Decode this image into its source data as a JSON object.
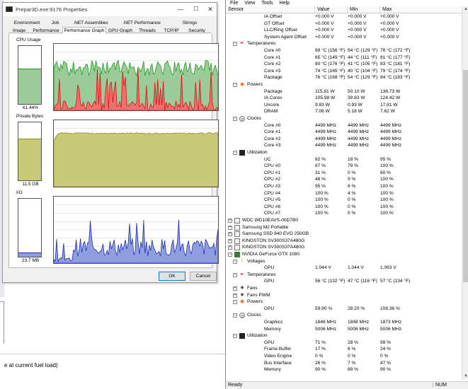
{
  "background": {
    "bottom_text": "e at current fuel load)"
  },
  "properties_window": {
    "title": "Prepar3D.exe:9176 Properties",
    "tabs_row1": [
      "Environment",
      "Job",
      ".NET Assemblies",
      ".NET Performance",
      "Strings"
    ],
    "tabs_row2": [
      "Image",
      "Performance",
      "Performance Graph",
      "GPU Graph",
      "Threads",
      "TCP/IP",
      "Security"
    ],
    "active_tab": "Performance Graph",
    "cpu": {
      "label": "CPU Usage",
      "value_text": "61.44%",
      "level": 0.6144
    },
    "private_bytes": {
      "label": "Private Bytes",
      "value_text": "11.5 GB",
      "level": 0.72
    },
    "io": {
      "label": "I/O",
      "value_text": "23.7 MB",
      "level": 0.07
    },
    "ok_label": "OK",
    "cancel_label": "Cancel",
    "colors": {
      "cpu_fill": "#9ccb9a",
      "cpu_line": "#1c9a1c",
      "kernel_fill": "#f07070",
      "kernel_line": "#d81010",
      "mem_fill": "#c9c97a",
      "mem_line": "#8a8a20",
      "io_fill": "#8f9ee0",
      "io_line": "#2030b0"
    }
  },
  "hwinfo": {
    "menu": [
      "File",
      "View",
      "Tools",
      "Help"
    ],
    "columns": {
      "sensor": "Sensor",
      "value": "Value",
      "min": "Min",
      "max": "Max"
    },
    "rows": [
      {
        "level": 3,
        "label": "IA Offset",
        "value": "+0.000 V",
        "min": "+0.000 V",
        "max": "+0.000 V"
      },
      {
        "level": 3,
        "label": "GT Offset",
        "value": "+0.000 V",
        "min": "+0.000 V",
        "max": "+0.000 V"
      },
      {
        "level": 3,
        "label": "LLC/Ring Offset",
        "value": "+0.000 V",
        "min": "+0.000 V",
        "max": "+0.000 V"
      },
      {
        "level": 3,
        "label": "System Agent Offset",
        "value": "+0.000 V",
        "min": "+0.000 V",
        "max": "+0.000 V"
      },
      {
        "level": 2,
        "label": "Temperatures",
        "icon": "thermometer-icon",
        "expander": "−"
      },
      {
        "level": 3,
        "label": "Core #0",
        "value": "69 °C  (156 °F)",
        "min": "54 °C  (129 °F)",
        "max": "78 °C  (172 °F)"
      },
      {
        "level": 3,
        "label": "Core #1",
        "value": "65 °C  (149 °F)",
        "min": "44 °C  (111 °F)",
        "max": "81 °C  (177 °F)"
      },
      {
        "level": 3,
        "label": "Core #2",
        "value": "80 °C  (176 °F)",
        "min": "41 °C  (105 °F)",
        "max": "83 °C  (181 °F)"
      },
      {
        "level": 3,
        "label": "Core #3",
        "value": "74 °C  (165 °F)",
        "min": "40 °C  (104 °F)",
        "max": "79 °C  (174 °F)"
      },
      {
        "level": 3,
        "label": "Package",
        "value": "76 °C  (168 °F)",
        "min": "54 °C  (129 °F)",
        "max": "84 °C  (183 °F)"
      },
      {
        "level": 2,
        "label": "Powers",
        "icon": "power-icon",
        "expander": "−"
      },
      {
        "level": 3,
        "label": "Package",
        "value": "115.81 W",
        "min": "50.10 W",
        "max": "136.73 W"
      },
      {
        "level": 3,
        "label": "IA Cores",
        "value": "105.98 W",
        "min": "39.83 W",
        "max": "124.42 W"
      },
      {
        "level": 3,
        "label": "Uncore",
        "value": "9.83 W",
        "min": "0.93 W",
        "max": "17.81 W"
      },
      {
        "level": 3,
        "label": "DRAM",
        "value": "7.06 W",
        "min": "5.18 W",
        "max": "7.62 W"
      },
      {
        "level": 2,
        "label": "Clocks",
        "icon": "clock-icon",
        "expander": "−"
      },
      {
        "level": 3,
        "label": "Core #0",
        "value": "4499 MHz",
        "min": "4499 MHz",
        "max": "4499 MHz"
      },
      {
        "level": 3,
        "label": "Core #1",
        "value": "4499 MHz",
        "min": "4499 MHz",
        "max": "4499 MHz"
      },
      {
        "level": 3,
        "label": "Core #2",
        "value": "4499 MHz",
        "min": "4499 MHz",
        "max": "4499 MHz"
      },
      {
        "level": 3,
        "label": "Core #3",
        "value": "4499 MHz",
        "min": "4499 MHz",
        "max": "4499 MHz"
      },
      {
        "level": 2,
        "label": "Utilization",
        "icon": "utilization-icon",
        "expander": "−"
      },
      {
        "level": 3,
        "label": "UC",
        "value": "82 %",
        "min": "18 %",
        "max": "95 %"
      },
      {
        "level": 3,
        "label": "CPU #0",
        "value": "87 %",
        "min": "79 %",
        "max": "100 %"
      },
      {
        "level": 3,
        "label": "CPU #1",
        "value": "31 %",
        "min": "0 %",
        "max": "60 %"
      },
      {
        "level": 3,
        "label": "CPU #2",
        "value": "48 %",
        "min": "9 %",
        "max": "100 %"
      },
      {
        "level": 3,
        "label": "CPU #3",
        "value": "95 %",
        "min": "6 %",
        "max": "100 %"
      },
      {
        "level": 3,
        "label": "CPU #4",
        "value": "100 %",
        "min": "4 %",
        "max": "100 %"
      },
      {
        "level": 3,
        "label": "CPU #5",
        "value": "100 %",
        "min": "0 %",
        "max": "100 %"
      },
      {
        "level": 3,
        "label": "CPU #6",
        "value": "100 %",
        "min": "0 %",
        "max": "100 %"
      },
      {
        "level": 3,
        "label": "CPU #7",
        "value": "100 %",
        "min": "0 %",
        "max": "100 %"
      },
      {
        "level": 0,
        "label": "WDC WD10EAVS-00D7B0",
        "icon": "hdd-icon",
        "expander": "+"
      },
      {
        "level": 0,
        "label": "Samsung M2 Portable",
        "icon": "hdd-icon",
        "expander": "+"
      },
      {
        "level": 0,
        "label": "Samsung SSD 840 EVO 250GB",
        "icon": "hdd-icon",
        "expander": "+"
      },
      {
        "level": 0,
        "label": "KINGSTON SV300S37A480G",
        "icon": "hdd-icon",
        "expander": "+"
      },
      {
        "level": 0,
        "label": "KINGSTON SV300S37A480G",
        "icon": "hdd-icon",
        "expander": "+"
      },
      {
        "level": 0,
        "label": "NVIDIA GeForce GTX 1080",
        "icon": "gpu-icon",
        "expander": "−"
      },
      {
        "level": 2,
        "label": "Voltages",
        "icon": "voltage-icon",
        "expander": "−"
      },
      {
        "level": 3,
        "label": "GPU",
        "value": "1.044 V",
        "min": "1.044 V",
        "max": "1.063 V"
      },
      {
        "level": 2,
        "label": "Temperatures",
        "icon": "thermometer-icon",
        "expander": "−"
      },
      {
        "level": 3,
        "label": "GPU",
        "value": "56 °C  (132 °F)",
        "min": "47 °C  (116 °F)",
        "max": "57 °C  (134 °F)"
      },
      {
        "level": 2,
        "label": "Fans",
        "icon": "fan-icon",
        "expander": "+"
      },
      {
        "level": 2,
        "label": "Fans PWM",
        "icon": "fan-icon",
        "expander": "+"
      },
      {
        "level": 2,
        "label": "Powers",
        "icon": "power-icon",
        "expander": "−"
      },
      {
        "level": 3,
        "label": "GPU",
        "value": "59.90 %",
        "min": "28.20 %",
        "max": "108.36 %"
      },
      {
        "level": 2,
        "label": "Clocks",
        "icon": "clock-icon",
        "expander": "−"
      },
      {
        "level": 3,
        "label": "Graphics",
        "value": "1848 MHz",
        "min": "1848 MHz",
        "max": "1873 MHz"
      },
      {
        "level": 3,
        "label": "Memory",
        "value": "5006 MHz",
        "min": "5006 MHz",
        "max": "5006 MHz"
      },
      {
        "level": 2,
        "label": "Utilization",
        "icon": "utilization-icon",
        "expander": "−"
      },
      {
        "level": 3,
        "label": "GPU",
        "value": "71 %",
        "min": "28 %",
        "max": "99 %"
      },
      {
        "level": 3,
        "label": "Frame Buffer",
        "value": "17 %",
        "min": "6 %",
        "max": "24 %"
      },
      {
        "level": 3,
        "label": "Video Engine",
        "value": "0 %",
        "min": "0 %",
        "max": "0 %"
      },
      {
        "level": 3,
        "label": "Bus Interface",
        "value": "26 %",
        "min": "7 %",
        "max": "47 %"
      },
      {
        "level": 3,
        "label": "Memory",
        "value": "90 %",
        "min": "89 %",
        "max": "90 %"
      }
    ],
    "status_left": "Ready",
    "status_num": "NUM"
  }
}
